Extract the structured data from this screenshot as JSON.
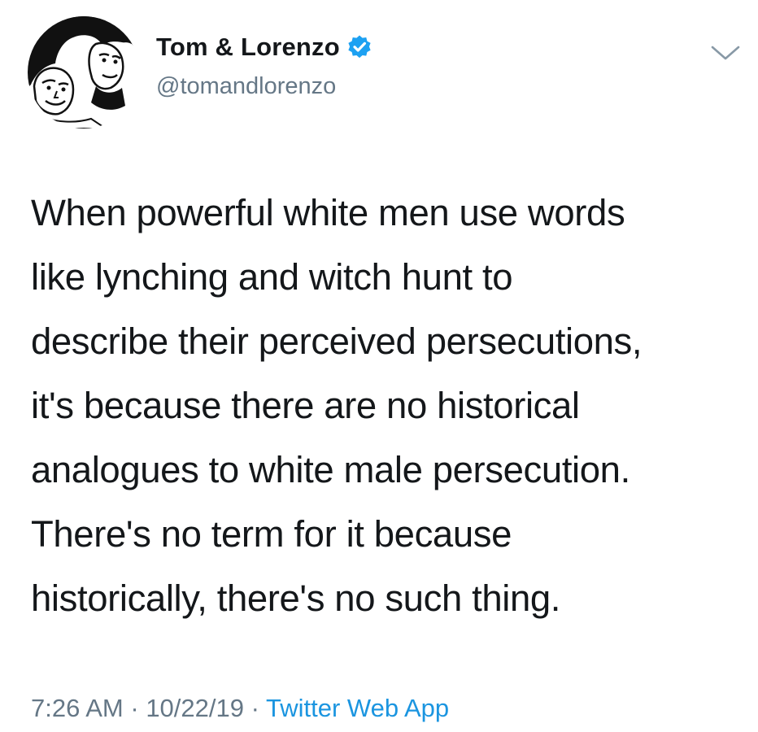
{
  "author": {
    "display_name": "Tom & Lorenzo",
    "handle": "@tomandlorenzo",
    "verified": true,
    "avatar_icon": "cartoon-duo-avatar-icon",
    "verified_icon": "verified-badge-icon",
    "verified_color": "#1da1f2"
  },
  "menu": {
    "icon": "chevron-down-icon"
  },
  "tweet": {
    "lines": [
      "When powerful white men use words",
      "like lynching and witch hunt to",
      "describe their perceived persecutions,",
      "it's because there are no historical",
      "analogues to white male persecution.",
      "There's no term for it because",
      "historically, there's no such thing."
    ]
  },
  "meta": {
    "time": "7:26 AM",
    "separator": " · ",
    "date": "10/22/19",
    "source": "Twitter Web App",
    "source_color": "#1b95e0"
  }
}
